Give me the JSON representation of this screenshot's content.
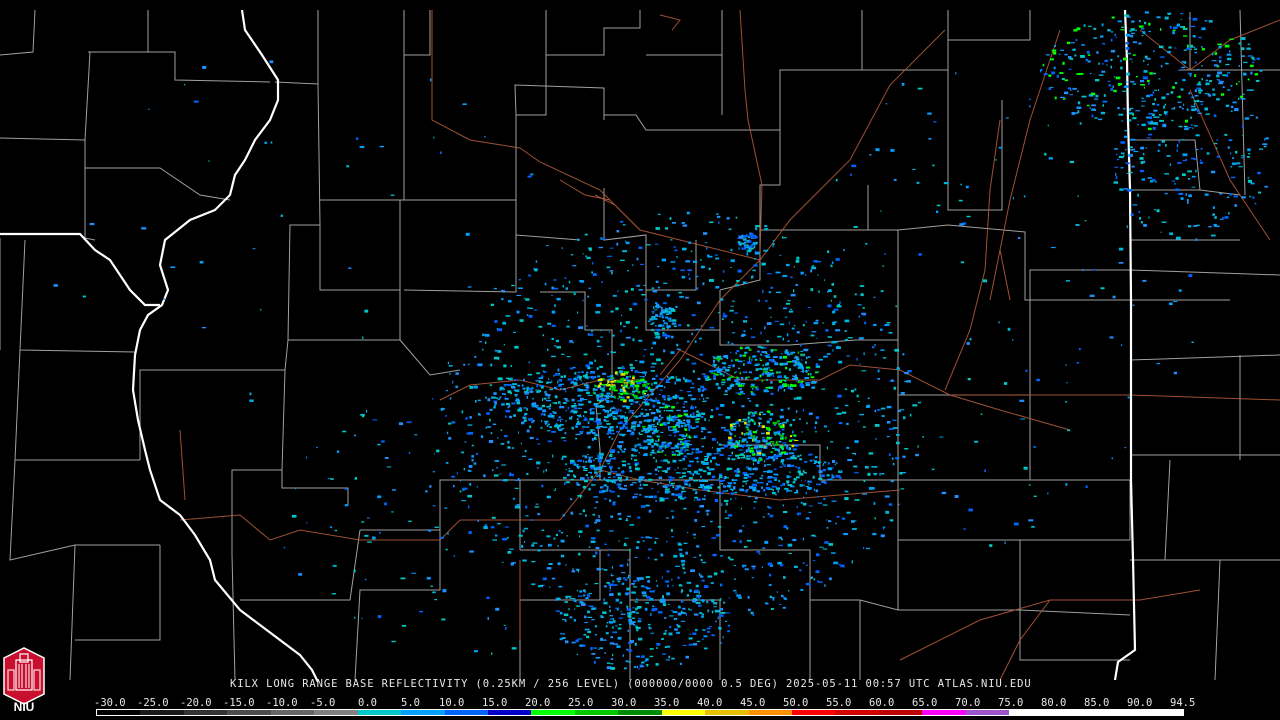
{
  "product": {
    "caption": "KILX LONG RANGE BASE REFLECTIVITY (0.25KM / 256 LEVEL) (000000/0000 0.5 DEG) 2025-05-11 00:57 UTC  ATLAS.NIU.EDU"
  },
  "scale": {
    "labels": [
      "-30.0",
      "-25.0",
      "-20.0",
      "-15.0",
      "-10.0",
      "-5.0",
      "0.0",
      "5.0",
      "10.0",
      "15.0",
      "20.0",
      "25.0",
      "30.0",
      "35.0",
      "40.0",
      "45.0",
      "50.0",
      "55.0",
      "60.0",
      "65.0",
      "70.0",
      "75.0",
      "80.0",
      "85.0",
      "90.0",
      "94.5"
    ],
    "colors": [
      "#000000",
      "#1a1a1a",
      "#333333",
      "#4d4d4d",
      "#666666",
      "#808080",
      "#00c8c8",
      "#00a0ff",
      "#0064ff",
      "#0000c8",
      "#00ff00",
      "#00c800",
      "#008c00",
      "#ffff00",
      "#e6c000",
      "#ff9000",
      "#ff0000",
      "#d40000",
      "#bc0000",
      "#ff00ff",
      "#9955c9",
      "#ffffff",
      "#ffffff",
      "#ffffff",
      "#ffffff"
    ]
  },
  "logo": {
    "text": "NIU",
    "icon": "niu-tower-logo-icon"
  },
  "colors": {
    "county_lines": "#bdbdbd",
    "roads": "#b05a3a",
    "state_lines": "#ffffff"
  }
}
